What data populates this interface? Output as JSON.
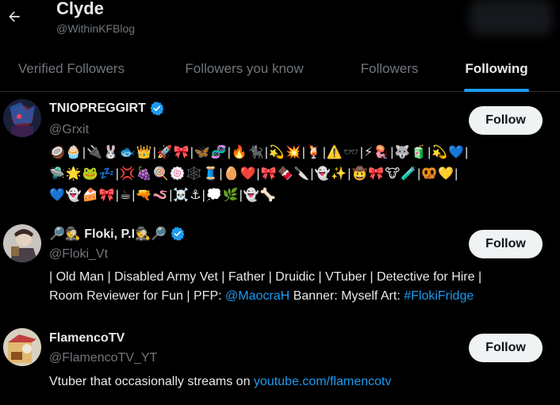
{
  "header": {
    "title": "Clyde",
    "handle": "@WithinKFBlog",
    "back_icon": "arrow-left-icon"
  },
  "tabs": [
    {
      "label": "Verified Followers",
      "active": false
    },
    {
      "label": "Followers you know",
      "active": false
    },
    {
      "label": "Followers",
      "active": false
    },
    {
      "label": "Following",
      "active": true
    }
  ],
  "accent": "#1d9bf0",
  "users": [
    {
      "name": "TNIOPREGGIRT",
      "handle": "@Grxit",
      "verified": true,
      "follow_label": "Follow",
      "bio_lines": [
        "🥥🧁|🔌🐰🐟👑|🚀🎀|🦋🧬|🔥🐈‍⬛|💫💥|🍹|⚠️🕶️|⚡🪼|🐺🧃|💫💙|",
        "🛸🌟🐸💤|💢🍇🍭🍥🕸️🧵|🥚❤️|🎀🍫🔪|👻✨|🤠🎀🐮🧪|🥨💛|",
        "💙👻🍰🎀|☕|🔫🪱|☠️⚓|💭🌿|👻🦴"
      ]
    },
    {
      "name": "🔎🕵️ Floki, P.I🕵️🔎",
      "handle": "@Floki_Vt",
      "verified": true,
      "follow_label": "Follow",
      "bio_line1": "| Old Man | Disabled Army Vet | Father | Druidic | VTuber | Detective for Hire |",
      "bio_line2_a": "Room Reviewer for Fun | PFP: ",
      "bio_line2_link1": "@MaocraH",
      "bio_line2_b": " Banner: Myself Art: ",
      "bio_line2_link2": "#FlokiFridge"
    },
    {
      "name": "FlamencoTV",
      "handle": "@FlamencoTV_YT",
      "verified": false,
      "follow_label": "Follow",
      "bio_text": "Vtuber that occasionally streams on ",
      "bio_link": "youtube.com/flamencotv"
    }
  ]
}
